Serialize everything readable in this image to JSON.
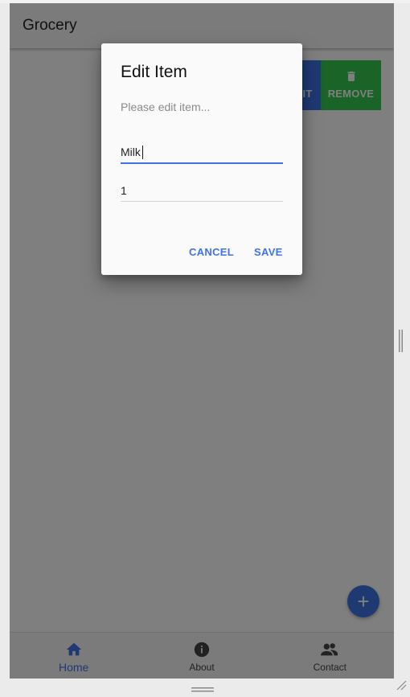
{
  "app": {
    "title": "Grocery"
  },
  "swipe_actions": {
    "edit_label": "IT",
    "remove_label": "REMOVE"
  },
  "dialog": {
    "title": "Edit Item",
    "message": "Please edit item...",
    "name_value": "Milk",
    "quantity_value": "1",
    "cancel_label": "CANCEL",
    "save_label": "SAVE"
  },
  "fab": {
    "icon": "plus-icon"
  },
  "bottom_nav": {
    "items": [
      {
        "label": "Home",
        "icon": "home-icon",
        "active": true
      },
      {
        "label": "About",
        "icon": "info-icon",
        "active": false
      },
      {
        "label": "Contact",
        "icon": "contacts-icon",
        "active": false
      }
    ]
  },
  "colors": {
    "primary": "#3f73e6",
    "remove": "#35c94f",
    "scrim": "rgba(0,0,0,0.5)"
  }
}
